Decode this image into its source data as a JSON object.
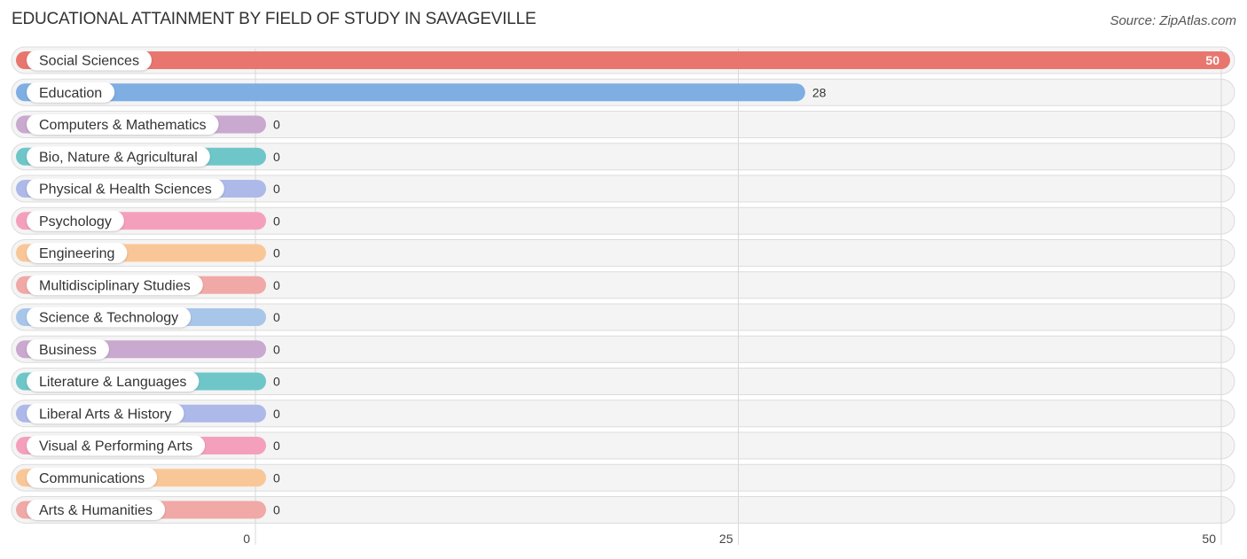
{
  "header": {
    "title": "EDUCATIONAL ATTAINMENT BY FIELD OF STUDY IN SAVAGEVILLE",
    "source": "Source: ZipAtlas.com"
  },
  "chart_data": {
    "type": "bar",
    "orientation": "horizontal",
    "title": "EDUCATIONAL ATTAINMENT BY FIELD OF STUDY IN SAVAGEVILLE",
    "xlabel": "",
    "ylabel": "",
    "xlim": [
      0,
      50
    ],
    "xticks": [
      0,
      25,
      50
    ],
    "grid": true,
    "categories": [
      "Social Sciences",
      "Education",
      "Computers & Mathematics",
      "Bio, Nature & Agricultural",
      "Physical & Health Sciences",
      "Psychology",
      "Engineering",
      "Multidisciplinary Studies",
      "Science & Technology",
      "Business",
      "Literature & Languages",
      "Liberal Arts & History",
      "Visual & Performing Arts",
      "Communications",
      "Arts & Humanities"
    ],
    "values": [
      50,
      28,
      0,
      0,
      0,
      0,
      0,
      0,
      0,
      0,
      0,
      0,
      0,
      0,
      0
    ],
    "colors": [
      "#e8766f",
      "#7eaee2",
      "#c9a9cf",
      "#6fc6c9",
      "#adb9e8",
      "#f4a0bd",
      "#f9c797",
      "#f0a9a6",
      "#a8c6ea",
      "#c9a9cf",
      "#6fc6c9",
      "#adb9e8",
      "#f4a0bd",
      "#f9c797",
      "#f0a9a6"
    ]
  }
}
